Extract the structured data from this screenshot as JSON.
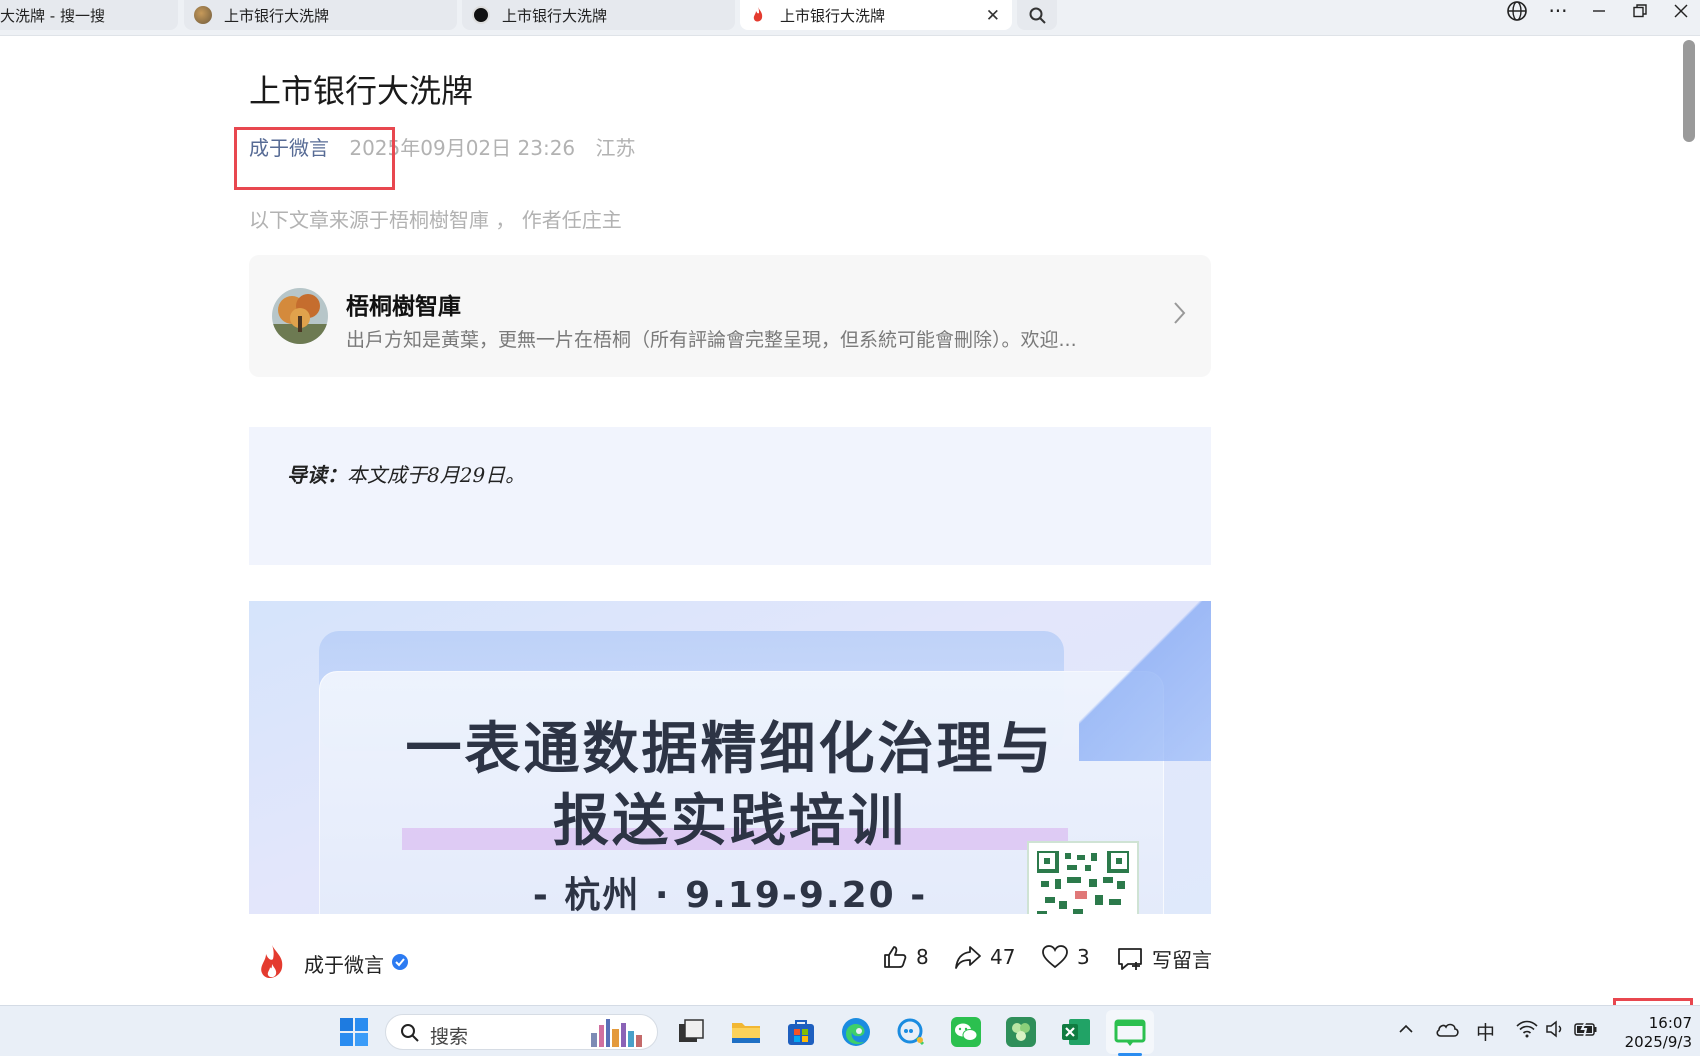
{
  "tabs": [
    {
      "label": "大洗牌 - 搜一搜"
    },
    {
      "label": "上市银行大洗牌"
    },
    {
      "label": "上市银行大洗牌"
    },
    {
      "label": "上市银行大洗牌",
      "active": true
    }
  ],
  "article": {
    "title": "上市银行大洗牌",
    "author": "成于微言",
    "date": "2025年09月02日 23:26",
    "location": "江苏",
    "source_note": "以下文章来源于梧桐樹智庫 ， 作者任庄主"
  },
  "account_card": {
    "name": "梧桐樹智庫",
    "description": "出戶方知是黃葉，更無一片在梧桐（所有評論會完整呈現，但系統可能會刪除）。欢迎..."
  },
  "intro": {
    "label": "导读：",
    "text": "本文成于8月29日。"
  },
  "banner": {
    "line1": "一表通数据精细化治理与",
    "line2": "报送实践培训",
    "line3": "-  杭州 · 9.19-9.20  -"
  },
  "footer": {
    "account": "成于微言",
    "likes": "8",
    "shares": "47",
    "favorites": "3",
    "comment_label": "写留言"
  },
  "taskbar": {
    "search_placeholder": "搜索",
    "ime": "中",
    "time": "16:07",
    "date": "2025/9/3"
  },
  "colors": {
    "author_link": "#576b95",
    "highlight_box": "#e8474f",
    "intro_bg": "#f1f4fd"
  }
}
